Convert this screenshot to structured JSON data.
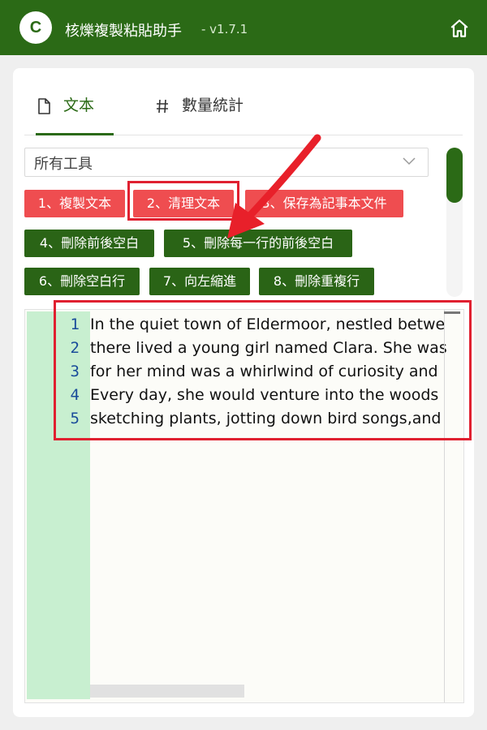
{
  "app": {
    "title": "核爍複製粘貼助手",
    "version": "- v1.7.1",
    "logo_text": "C"
  },
  "header": {
    "home_icon": "home-icon"
  },
  "tabs": [
    {
      "label": "文本",
      "icon": "document-icon",
      "active": true
    },
    {
      "label": "數量統計",
      "icon": "hash-icon",
      "active": false
    }
  ],
  "tool_select": {
    "value": "所有工具"
  },
  "buttons": [
    {
      "label": "1、複製文本",
      "color": "#ef4d50"
    },
    {
      "label": "2、清理文本",
      "color": "#ef4d50"
    },
    {
      "label": "3、保存為記事本文件",
      "color": "#ef4d50"
    },
    {
      "label": "4、刪除前後空白",
      "color": "#2a6416"
    },
    {
      "label": "5、刪除每一行的前後空白",
      "color": "#2a6416"
    },
    {
      "label": "6、刪除空白行",
      "color": "#2a6416"
    },
    {
      "label": "7、向左縮進",
      "color": "#2a6416"
    },
    {
      "label": "8、刪除重複行",
      "color": "#2a6416"
    }
  ],
  "editor": {
    "line_numbers": [
      "1",
      "2",
      "3",
      "4",
      "5"
    ],
    "lines": [
      "In the quiet town of Eldermoor, nestled betwe",
      "there lived a young girl named Clara. She was",
      "for her mind was a whirlwind of curiosity and",
      "Every day, she would venture into the woods",
      "sketching plants, jotting down bird songs,and"
    ]
  },
  "colors": {
    "brand": "#2b6a16",
    "accent_red": "#ef4d50",
    "annotation": "#e02030",
    "gutter": "#c8efd0"
  }
}
